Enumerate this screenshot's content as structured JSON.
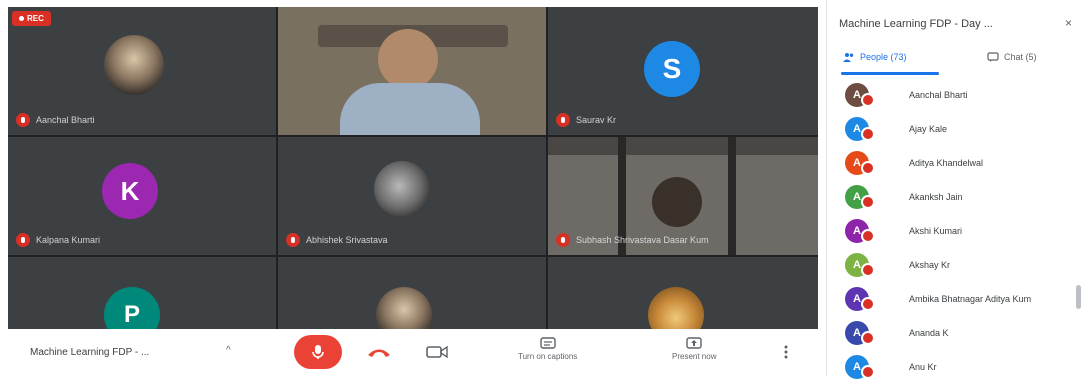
{
  "recording": {
    "label": "REC"
  },
  "tiles": [
    {
      "name": "Aanchal Bharti",
      "type": "photo",
      "initial": ""
    },
    {
      "name": "",
      "type": "video",
      "initial": ""
    },
    {
      "name": "Saurav Kr",
      "type": "initial",
      "initial": "S",
      "color": "#1e88e5"
    },
    {
      "name": "Kalpana Kumari",
      "type": "initial",
      "initial": "K",
      "color": "#9c27b0"
    },
    {
      "name": "Abhishek Srivastava",
      "type": "photo",
      "initial": ""
    },
    {
      "name": "Subhash Shrivastava Dasar Kum",
      "type": "video",
      "initial": ""
    },
    {
      "name": "",
      "type": "initial",
      "initial": "P",
      "color": "#00897b"
    },
    {
      "name": "",
      "type": "photo",
      "initial": ""
    },
    {
      "name": "",
      "type": "photo",
      "initial": ""
    }
  ],
  "bottom_bar": {
    "meeting_name": "Machine Learning FDP - ...",
    "turn_on_captions": "Turn on captions",
    "present_now": "Present now",
    "more_icon": "more-vert-icon"
  },
  "sidebar": {
    "title": "Machine Learning FDP - Day ...",
    "tabs": [
      {
        "label": "People (73)"
      },
      {
        "label": "Chat (5)"
      }
    ],
    "people": [
      {
        "name": "Aanchal Bharti",
        "initial": "A",
        "color": "#6d4c41"
      },
      {
        "name": "Ajay Kale",
        "initial": "A",
        "color": "#1e88e5"
      },
      {
        "name": "Aditya Khandelwal",
        "initial": "A",
        "color": "#e64a19"
      },
      {
        "name": "Akanksh Jain",
        "initial": "A",
        "color": "#43a047"
      },
      {
        "name": "Akshi Kumari",
        "initial": "A",
        "color": "#8e24aa"
      },
      {
        "name": "Akshay Kr",
        "initial": "A",
        "color": "#7cb342"
      },
      {
        "name": "Ambika Bhatnagar Aditya Kum",
        "initial": "A",
        "color": "#5e35b1"
      },
      {
        "name": "Ananda K",
        "initial": "A",
        "color": "#3949ab"
      },
      {
        "name": "Anu Kr",
        "initial": "A",
        "color": "#1e88e5"
      }
    ]
  }
}
